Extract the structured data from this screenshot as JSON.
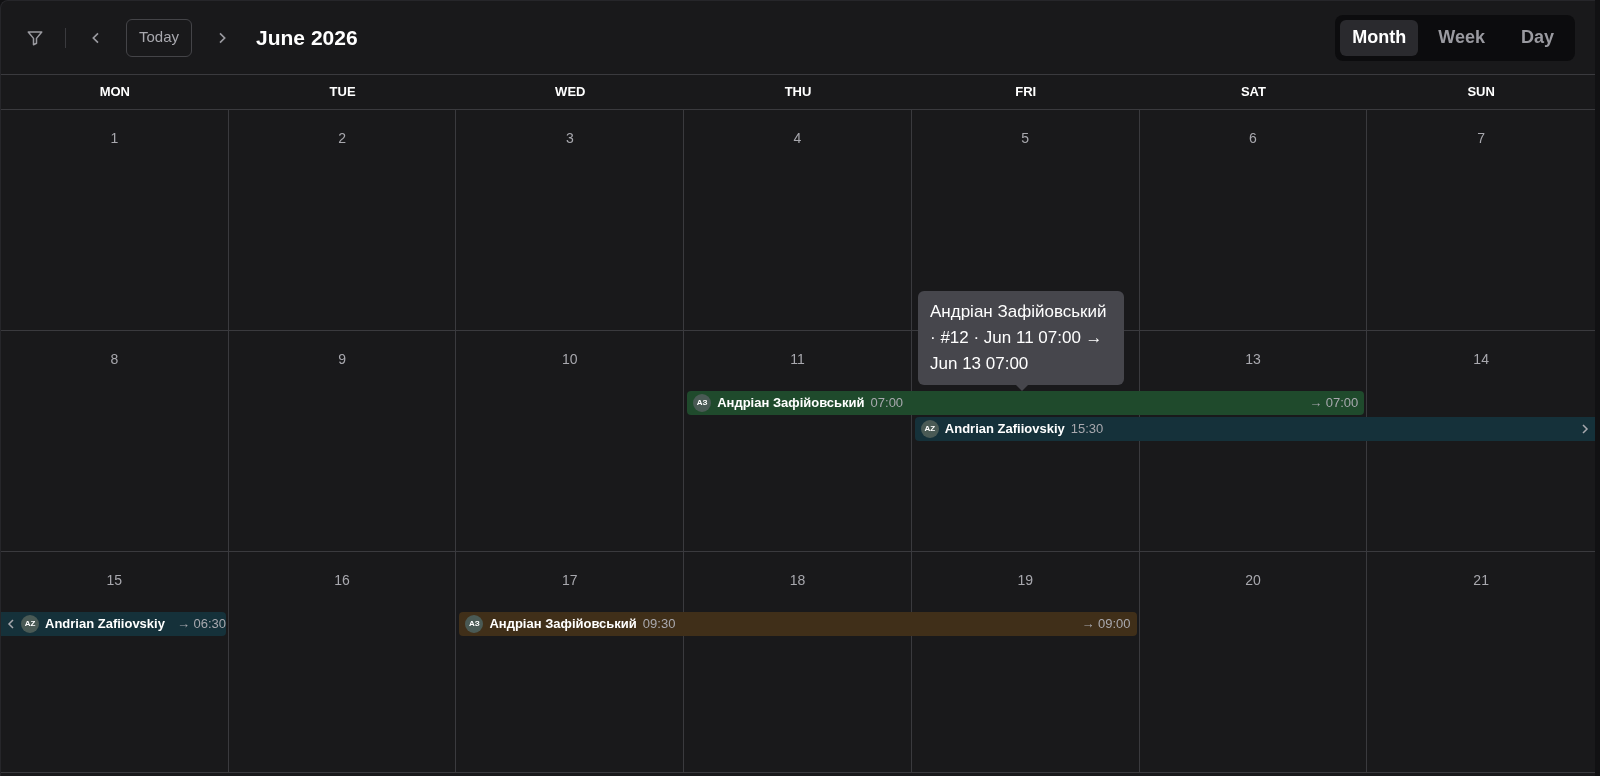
{
  "toolbar": {
    "today_button": "Today",
    "title": "June 2026"
  },
  "views": [
    {
      "label": "Month",
      "selected": true
    },
    {
      "label": "Week",
      "selected": false
    },
    {
      "label": "Day",
      "selected": false
    }
  ],
  "weekdays": [
    "MON",
    "TUE",
    "WED",
    "THU",
    "FRI",
    "SAT",
    "SUN"
  ],
  "weeks": [
    {
      "days": [
        "1",
        "2",
        "3",
        "4",
        "5",
        "6",
        "7"
      ]
    },
    {
      "days": [
        "8",
        "9",
        "10",
        "11",
        "13",
        "14"
      ],
      "events": [
        {
          "initials": "АЗ",
          "name": "Андріан Зафійовський",
          "start": "07:00",
          "end": "→ 07:00",
          "color": "#1f4a2c",
          "continues_left": false,
          "continues_right": false,
          "hovered": true,
          "tooltip": "Андріан Зафійовський · #12 · Jun 11 07:00 → Jun 13 07:00"
        },
        {
          "initials": "AZ",
          "name": "Andrian Zafiiovskiy",
          "start": "15:30",
          "color": "#15313a",
          "continues_left": false,
          "continues_right": true,
          "hovered": false
        }
      ]
    },
    {
      "days": [
        "15",
        "16",
        "17",
        "18",
        "19",
        "20",
        "21"
      ],
      "events": [
        {
          "initials": "AZ",
          "name": "Andrian Zafiiovskiy",
          "end": "→ 06:30",
          "color": "#15313a",
          "continues_left": true,
          "continues_right": false,
          "hovered": false
        },
        {
          "initials": "АЗ",
          "name": "Андріан Зафійовський",
          "start": "09:30",
          "end": "→ 09:00",
          "color": "#402f19",
          "continues_left": false,
          "continues_right": false,
          "hovered": false
        }
      ]
    }
  ]
}
